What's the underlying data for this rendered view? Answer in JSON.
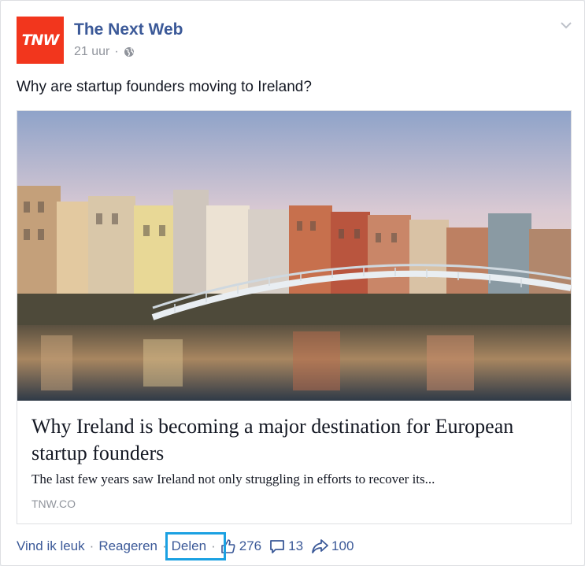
{
  "post": {
    "page_name": "The Next Web",
    "avatar_text": "TNW",
    "timestamp": "21 uur",
    "meta_separator": "·",
    "message": "Why are startup founders moving to Ireland?"
  },
  "link": {
    "title": "Why Ireland is becoming a major destination for European startup founders",
    "description": "The last few years saw Ireland not only struggling in efforts to recover its...",
    "domain": "TNW.CO"
  },
  "actions": {
    "like": "Vind ik leuk",
    "comment": "Reageren",
    "share": "Delen",
    "separator": "·",
    "like_count": "276",
    "comment_count": "13",
    "share_count": "100"
  },
  "colors": {
    "brand_blue": "#3b5998",
    "avatar_red": "#f2361d",
    "highlight": "#1ba1e2"
  },
  "icons": [
    "globe-icon",
    "chevron-down-icon",
    "thumbs-up-icon",
    "comment-icon",
    "share-arrow-icon"
  ]
}
